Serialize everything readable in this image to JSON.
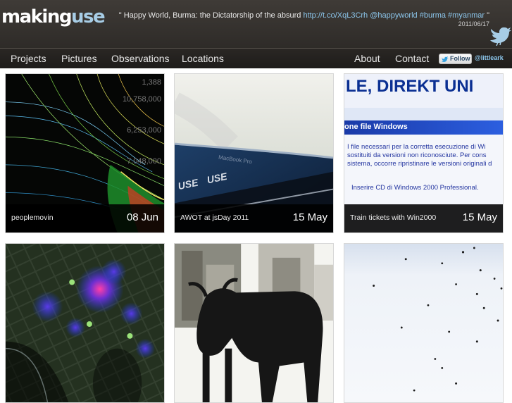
{
  "header": {
    "logo_part1": "making",
    "logo_part2": "use",
    "tweet": {
      "text": "\" Happy World, Burma: the Dictatorship of the absurd ",
      "link": "http://t.co/XqL3Crh",
      "tags": " @happyworld #burma #myanmar",
      "close": " \"",
      "date": "2011/06/17"
    },
    "bird_icon": "twitter-bird-icon"
  },
  "nav": {
    "items": [
      "Projects",
      "Pictures",
      "Observations",
      "Locations"
    ],
    "right_items": [
      "About",
      "Contact"
    ],
    "follow_label": "Follow",
    "twitter_handle": "@littleark"
  },
  "tiles": [
    {
      "title": "peoplemovin",
      "date": "08 Jun"
    },
    {
      "title": "AWOT at jsDay 2011",
      "date": "15 May"
    },
    {
      "title": "Train tickets with Win2000",
      "date": "15 May"
    },
    {
      "title": "",
      "date": ""
    },
    {
      "title": "",
      "date": ""
    },
    {
      "title": "",
      "date": ""
    }
  ],
  "tile3_screen": {
    "banner": "LE, DIREKT UNI",
    "window_title": "one file Windows",
    "line1": "I file necessari per la corretta esecuzione di Wi",
    "line2": "sostituiti da versioni non riconosciute. Per cons",
    "line3": "sistema, occorre ripristinare le versioni originali d",
    "line4": "Inserire CD di Windows 2000 Professional."
  },
  "tile1_numbers": [
    "1,388",
    "10,758,000",
    "6,253,000",
    "7,048,000"
  ],
  "tile2_laptop": {
    "model": "MacBook Pro",
    "sticker": "USE"
  },
  "colors": {
    "accent": "#a7cde6",
    "link": "#8cc6ec",
    "header_bg": "#3a3632",
    "nav_bg": "#262320"
  }
}
